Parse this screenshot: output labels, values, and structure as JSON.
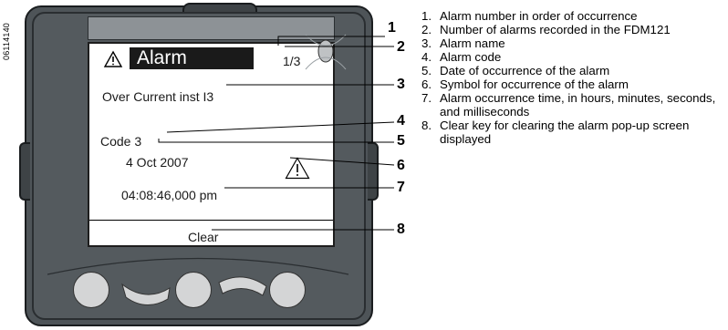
{
  "figure_code": "06114140",
  "screen": {
    "title": "Alarm",
    "counter": "1/3",
    "alarm_name": "Over Current inst I3",
    "alarm_code": "Code 3",
    "date": "4 Oct 2007",
    "time": "04:08:46,000 pm",
    "clear_key": "Clear"
  },
  "callouts": [
    "1",
    "2",
    "3",
    "4",
    "5",
    "6",
    "7",
    "8"
  ],
  "legend": [
    {
      "num": "1.",
      "text": "Alarm number in order of occurrence"
    },
    {
      "num": "2.",
      "text": "Number of alarms recorded in the FDM121"
    },
    {
      "num": "3.",
      "text": "Alarm name"
    },
    {
      "num": "4.",
      "text": "Alarm code"
    },
    {
      "num": "5.",
      "text": "Date of occurrence of the alarm"
    },
    {
      "num": "6.",
      "text": "Symbol for occurrence of the alarm"
    },
    {
      "num": "7.",
      "text": "Alarm occurrence time, in hours, minutes, seconds, and milliseconds"
    },
    {
      "num": "8.",
      "text": "Clear key for clearing the alarm pop-up screen displayed"
    }
  ],
  "icons": {
    "warning": "warning-triangle-icon",
    "led": "status-led-icon",
    "keys": [
      "keypad-button",
      "arrow-key",
      "keypad-button",
      "arrow-key",
      "keypad-button"
    ]
  },
  "colors": {
    "device_body": "#4e5458",
    "screen_bg": "#ffffff",
    "title_bg": "#1a1a1a",
    "key": "#d4d5d6"
  }
}
